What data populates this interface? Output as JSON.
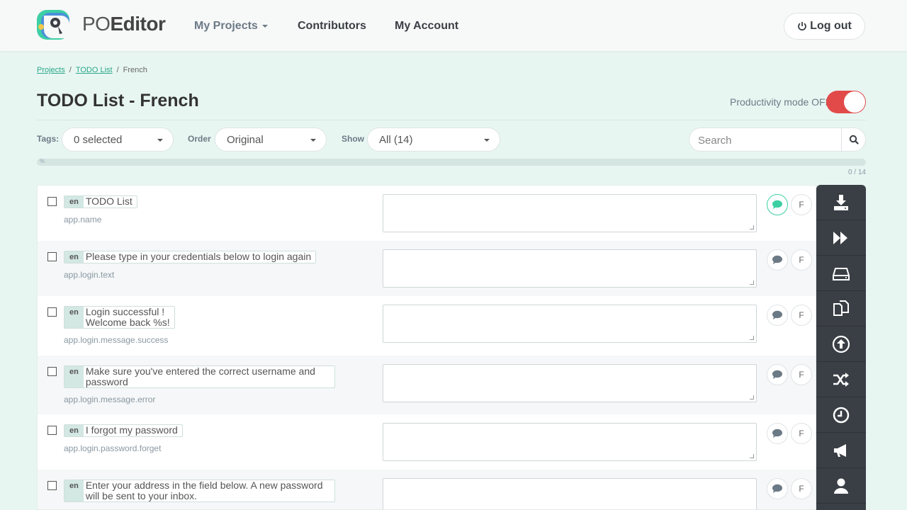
{
  "brand": {
    "prefix": "PO",
    "suffix": "Editor"
  },
  "nav": {
    "my_projects": "My Projects",
    "contributors": "Contributors",
    "my_account": "My Account",
    "logout": "Log out"
  },
  "breadcrumb": {
    "projects": "Projects",
    "list": "TODO List",
    "current": "French",
    "separator": "/"
  },
  "page": {
    "title": "TODO List - French",
    "productivity_label": "Productivity mode OFF",
    "productivity_on": false
  },
  "filters": {
    "tags_label": "Tags:",
    "tags_value": "0 selected",
    "order_label": "Order",
    "order_value": "Original",
    "show_label": "Show",
    "show_value": "All (14)",
    "search_placeholder": "Search"
  },
  "progress": {
    "pct_label": "%",
    "count": "0 / 14",
    "fraction": 0
  },
  "colors": {
    "accent": "#2aa88a",
    "toggle_off": "#e24a4a",
    "rail": "#3a3f45",
    "comment_active": "#3dcfa4"
  },
  "terms": [
    {
      "lang": "en",
      "lines": [
        "TODO List"
      ],
      "key": "app.name",
      "translation": "",
      "comment_active": true,
      "flag": "F"
    },
    {
      "lang": "en",
      "lines": [
        "Please type in your credentials below to login again"
      ],
      "key": "app.login.text",
      "translation": "",
      "comment_active": false,
      "flag": "F"
    },
    {
      "lang": "en",
      "lines": [
        "Login successful !",
        "Welcome back %s!"
      ],
      "key": "app.login.message.success",
      "translation": "",
      "comment_active": false,
      "flag": "F"
    },
    {
      "lang": "en",
      "lines": [
        "Make sure you've entered the correct username and",
        "password"
      ],
      "key": "app.login.message.error",
      "translation": "",
      "comment_active": false,
      "flag": "F"
    },
    {
      "lang": "en",
      "lines": [
        "I forgot my password"
      ],
      "key": "app.login.password.forget",
      "translation": "",
      "comment_active": false,
      "flag": "F"
    },
    {
      "lang": "en",
      "lines": [
        "Enter your address in the field below. A new password",
        "will be sent to your inbox."
      ],
      "key": "",
      "translation": "",
      "comment_active": false,
      "flag": "F"
    }
  ],
  "rail": [
    "download-icon",
    "fast-forward-icon",
    "drive-icon",
    "copy-icon",
    "upload-icon",
    "shuffle-icon",
    "history-icon",
    "megaphone-icon",
    "user-icon"
  ]
}
